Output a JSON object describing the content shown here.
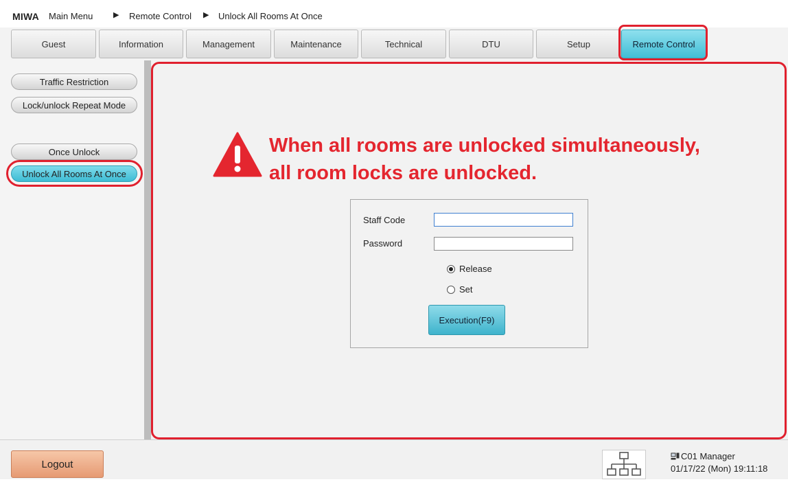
{
  "breadcrumb": {
    "brand": "MIWA",
    "items": [
      "Main Menu",
      "Remote Control",
      "Unlock All Rooms At Once"
    ]
  },
  "tabs": [
    {
      "label": "Guest"
    },
    {
      "label": "Information"
    },
    {
      "label": "Management"
    },
    {
      "label": "Maintenance"
    },
    {
      "label": "Technical"
    },
    {
      "label": "DTU"
    },
    {
      "label": "Setup"
    },
    {
      "label": "Remote Control",
      "active": true
    }
  ],
  "sidebar": {
    "items": [
      {
        "label": "Traffic Restriction"
      },
      {
        "label": "Lock/unlock Repeat Mode"
      },
      {
        "label": "Once Unlock"
      },
      {
        "label": "Unlock All Rooms At Once",
        "active": true
      }
    ]
  },
  "warning": {
    "line1": "When all rooms are unlocked simultaneously,",
    "line2": "all room locks are unlocked.",
    "color": "#e4262f"
  },
  "form": {
    "staff_code_label": "Staff Code",
    "staff_code_value": "",
    "password_label": "Password",
    "password_value": "",
    "radio_options": [
      {
        "label": "Release",
        "checked": true
      },
      {
        "label": "Set",
        "checked": false
      }
    ],
    "execute_label": "Execution(F9)"
  },
  "footer": {
    "logout_label": "Logout",
    "user": "C01 Manager",
    "datetime": "01/17/22 (Mon) 19:11:18"
  },
  "colors": {
    "accent": "#41bed6",
    "highlight": "#e0202e",
    "logout": "#e69a73"
  }
}
